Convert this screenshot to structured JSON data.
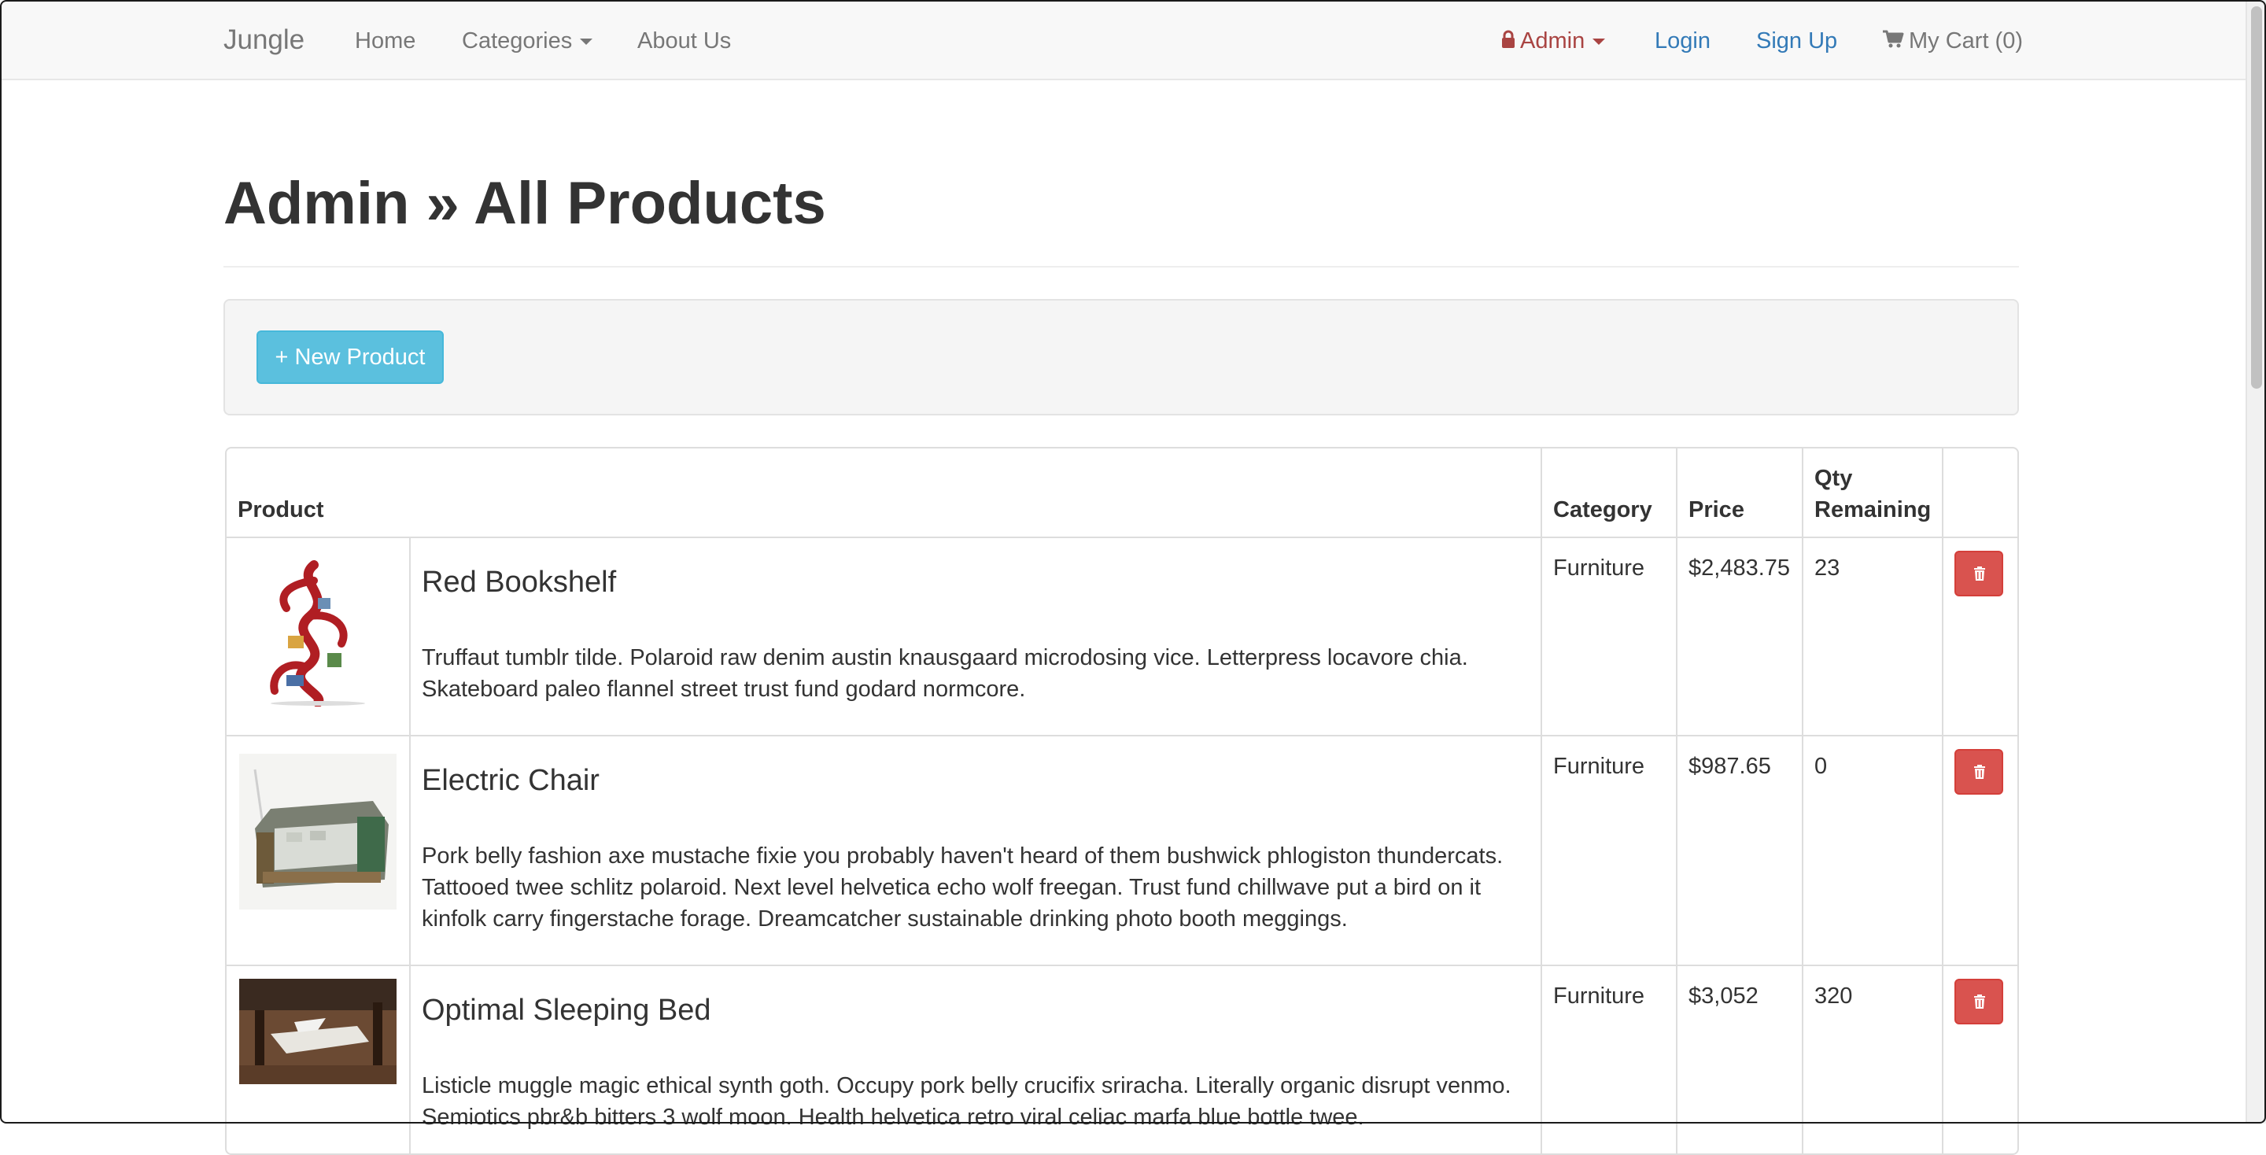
{
  "nav": {
    "brand": "Jungle",
    "home": "Home",
    "categories": "Categories",
    "about": "About Us",
    "admin": "Admin",
    "login": "Login",
    "signup": "Sign Up",
    "cart": "My Cart (0)"
  },
  "page": {
    "title": "Admin » All Products",
    "new_product_button": "+ New Product"
  },
  "table": {
    "headers": {
      "product": "Product",
      "category": "Category",
      "price": "Price",
      "qty_line1": "Qty",
      "qty_line2": "Remaining"
    },
    "rows": [
      {
        "name": "Red Bookshelf",
        "description": "Truffaut tumblr tilde. Polaroid raw denim austin knausgaard microdosing vice. Letterpress locavore chia. Skateboard paleo flannel street trust fund godard normcore.",
        "category": "Furniture",
        "price": "$2,483.75",
        "qty": "23"
      },
      {
        "name": "Electric Chair",
        "description": "Pork belly fashion axe mustache fixie you probably haven't heard of them bushwick phlogiston thundercats. Tattooed twee schlitz polaroid. Next level helvetica echo wolf freegan. Trust fund chillwave put a bird on it kinfolk carry fingerstache forage. Dreamcatcher sustainable drinking photo booth meggings.",
        "category": "Furniture",
        "price": "$987.65",
        "qty": "0"
      },
      {
        "name": "Optimal Sleeping Bed",
        "description": "Listicle muggle magic ethical synth goth. Occupy pork belly crucifix sriracha. Literally organic disrupt venmo. Semiotics pbr&b bitters 3 wolf moon. Health helvetica retro viral celiac marfa blue bottle twee.",
        "category": "Furniture",
        "price": "$3,052",
        "qty": "320"
      }
    ]
  },
  "colors": {
    "navbar_bg": "#f8f8f8",
    "admin_red": "#a94442",
    "link_blue": "#337ab7",
    "info_button": "#5bc0de",
    "danger_button": "#d9534f"
  },
  "icons": {
    "admin": "lock-icon",
    "cart": "shopping-cart-icon",
    "delete": "trash-icon"
  }
}
